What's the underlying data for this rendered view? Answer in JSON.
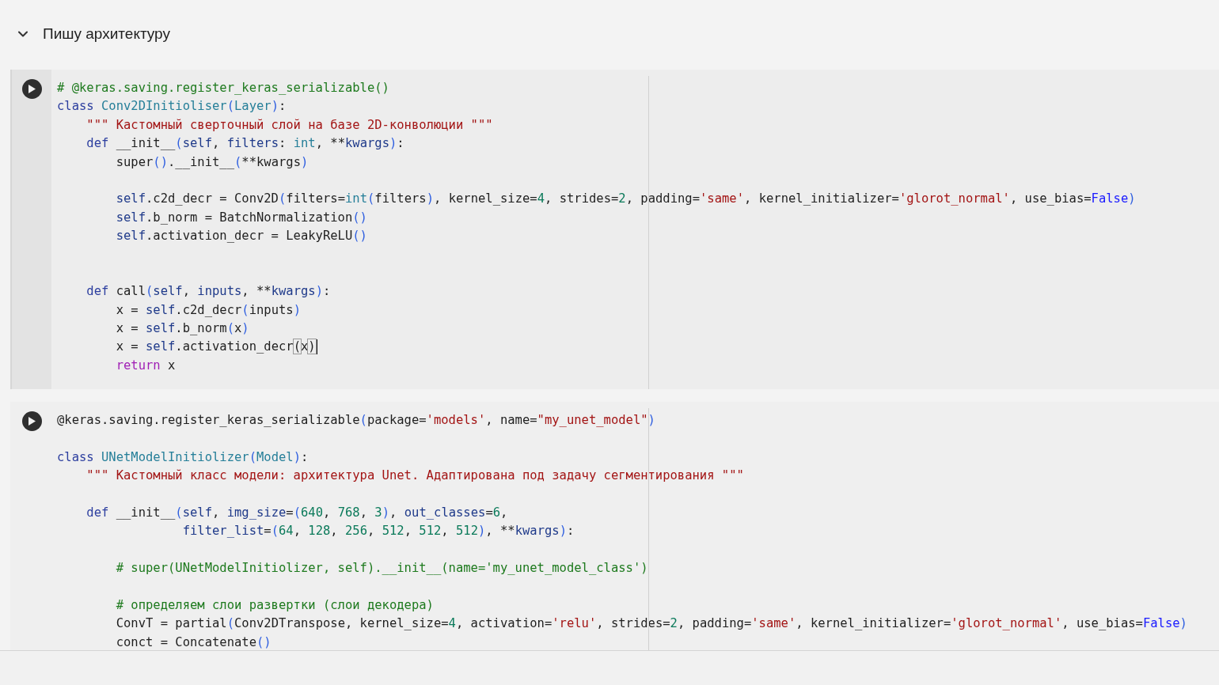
{
  "section": {
    "title": "Пишу архитектуру",
    "expanded": true
  },
  "cells": [
    {
      "focused": true,
      "lines": [
        {
          "kind": "code",
          "tokens": [
            {
              "kind": "comment",
              "text": "# @keras.saving.register_keras_serializable()"
            }
          ]
        },
        {
          "kind": "code",
          "tokens": [
            {
              "kind": "keyword",
              "text": "class "
            },
            {
              "kind": "type",
              "text": "Conv2DInitioliser"
            },
            {
              "kind": "paren",
              "text": "("
            },
            {
              "kind": "type",
              "text": "Layer"
            },
            {
              "kind": "paren",
              "text": ")"
            },
            {
              "kind": "plain",
              "text": ":"
            }
          ]
        },
        {
          "kind": "code",
          "tokens": [
            {
              "kind": "string",
              "text": "    \"\"\" Кастомный сверточный слой на базе 2D-конволюции \"\"\""
            }
          ]
        },
        {
          "kind": "code",
          "tokens": [
            {
              "kind": "keyword",
              "text": "    def"
            },
            {
              "kind": "plain",
              "text": " __init__"
            },
            {
              "kind": "paren",
              "text": "("
            },
            {
              "kind": "variable",
              "text": "self"
            },
            {
              "kind": "plain",
              "text": ", "
            },
            {
              "kind": "variable",
              "text": "filters"
            },
            {
              "kind": "plain",
              "text": ": "
            },
            {
              "kind": "type",
              "text": "int"
            },
            {
              "kind": "plain",
              "text": ", **"
            },
            {
              "kind": "variable",
              "text": "kwargs"
            },
            {
              "kind": "paren",
              "text": ")"
            },
            {
              "kind": "plain",
              "text": ":"
            }
          ]
        },
        {
          "kind": "code",
          "tokens": [
            {
              "kind": "plain",
              "text": "        super"
            },
            {
              "kind": "paren",
              "text": "()"
            },
            {
              "kind": "plain",
              "text": ".__init__"
            },
            {
              "kind": "paren",
              "text": "("
            },
            {
              "kind": "plain",
              "text": "**kwargs"
            },
            {
              "kind": "paren",
              "text": ")"
            }
          ]
        },
        {
          "kind": "blank"
        },
        {
          "kind": "code",
          "tokens": [
            {
              "kind": "variable",
              "text": "        self"
            },
            {
              "kind": "plain",
              "text": ".c2d_decr = Conv2D"
            },
            {
              "kind": "paren",
              "text": "("
            },
            {
              "kind": "plain",
              "text": "filters="
            },
            {
              "kind": "type",
              "text": "int"
            },
            {
              "kind": "paren",
              "text": "("
            },
            {
              "kind": "plain",
              "text": "filters"
            },
            {
              "kind": "paren",
              "text": ")"
            },
            {
              "kind": "plain",
              "text": ", kernel_size="
            },
            {
              "kind": "number",
              "text": "4"
            },
            {
              "kind": "plain",
              "text": ", strides="
            },
            {
              "kind": "number",
              "text": "2"
            },
            {
              "kind": "plain",
              "text": ", padding="
            },
            {
              "kind": "string",
              "text": "'same'"
            },
            {
              "kind": "plain",
              "text": ", kernel_initializer="
            },
            {
              "kind": "string",
              "text": "'glorot_normal'"
            },
            {
              "kind": "plain",
              "text": ", use_bias="
            },
            {
              "kind": "constant",
              "text": "False"
            },
            {
              "kind": "paren",
              "text": ")"
            }
          ]
        },
        {
          "kind": "code",
          "tokens": [
            {
              "kind": "variable",
              "text": "        self"
            },
            {
              "kind": "plain",
              "text": ".b_norm = BatchNormalization"
            },
            {
              "kind": "paren",
              "text": "()"
            }
          ]
        },
        {
          "kind": "code",
          "tokens": [
            {
              "kind": "variable",
              "text": "        self"
            },
            {
              "kind": "plain",
              "text": ".activation_decr = LeakyReLU"
            },
            {
              "kind": "paren",
              "text": "()"
            }
          ]
        },
        {
          "kind": "blank"
        },
        {
          "kind": "blank"
        },
        {
          "kind": "code",
          "tokens": [
            {
              "kind": "keyword",
              "text": "    def"
            },
            {
              "kind": "plain",
              "text": " call"
            },
            {
              "kind": "paren",
              "text": "("
            },
            {
              "kind": "variable",
              "text": "self"
            },
            {
              "kind": "plain",
              "text": ", "
            },
            {
              "kind": "variable",
              "text": "inputs"
            },
            {
              "kind": "plain",
              "text": ", **"
            },
            {
              "kind": "variable",
              "text": "kwargs"
            },
            {
              "kind": "paren",
              "text": ")"
            },
            {
              "kind": "plain",
              "text": ":"
            }
          ]
        },
        {
          "kind": "code",
          "tokens": [
            {
              "kind": "plain",
              "text": "        x = "
            },
            {
              "kind": "variable",
              "text": "self"
            },
            {
              "kind": "plain",
              "text": ".c2d_decr"
            },
            {
              "kind": "paren",
              "text": "("
            },
            {
              "kind": "plain",
              "text": "inputs"
            },
            {
              "kind": "paren",
              "text": ")"
            }
          ]
        },
        {
          "kind": "code",
          "tokens": [
            {
              "kind": "plain",
              "text": "        x = "
            },
            {
              "kind": "variable",
              "text": "self"
            },
            {
              "kind": "plain",
              "text": ".b_norm"
            },
            {
              "kind": "paren",
              "text": "("
            },
            {
              "kind": "plain",
              "text": "x"
            },
            {
              "kind": "paren",
              "text": ")"
            }
          ]
        },
        {
          "kind": "code",
          "cursor": true,
          "tokens": [
            {
              "kind": "plain",
              "text": "        x = "
            },
            {
              "kind": "variable",
              "text": "self"
            },
            {
              "kind": "plain",
              "text": ".activation_decr"
            },
            {
              "kind": "match",
              "text": "("
            },
            {
              "kind": "plain",
              "text": "x"
            },
            {
              "kind": "match",
              "text": ")"
            }
          ]
        },
        {
          "kind": "code",
          "tokens": [
            {
              "kind": "control",
              "text": "        return"
            },
            {
              "kind": "plain",
              "text": " x"
            }
          ]
        }
      ]
    },
    {
      "focused": false,
      "lines": [
        {
          "kind": "code",
          "tokens": [
            {
              "kind": "plain",
              "text": "@keras.saving.register_keras_serializable"
            },
            {
              "kind": "paren",
              "text": "("
            },
            {
              "kind": "plain",
              "text": "package="
            },
            {
              "kind": "string",
              "text": "'models'"
            },
            {
              "kind": "plain",
              "text": ", name="
            },
            {
              "kind": "string",
              "text": "\"my_unet_model\""
            },
            {
              "kind": "paren",
              "text": ")"
            }
          ]
        },
        {
          "kind": "blank"
        },
        {
          "kind": "code",
          "tokens": [
            {
              "kind": "keyword",
              "text": "class "
            },
            {
              "kind": "type",
              "text": "UNetModelInitiolizer"
            },
            {
              "kind": "paren",
              "text": "("
            },
            {
              "kind": "type",
              "text": "Model"
            },
            {
              "kind": "paren",
              "text": ")"
            },
            {
              "kind": "plain",
              "text": ":"
            }
          ]
        },
        {
          "kind": "code",
          "tokens": [
            {
              "kind": "string",
              "text": "    \"\"\" Кастомный класс модели: архитектура Unet. Адаптирована под задачу сегментирования \"\"\""
            }
          ]
        },
        {
          "kind": "blank"
        },
        {
          "kind": "code",
          "tokens": [
            {
              "kind": "keyword",
              "text": "    def"
            },
            {
              "kind": "plain",
              "text": " __init__"
            },
            {
              "kind": "paren",
              "text": "("
            },
            {
              "kind": "variable",
              "text": "self"
            },
            {
              "kind": "plain",
              "text": ", "
            },
            {
              "kind": "variable",
              "text": "img_size"
            },
            {
              "kind": "plain",
              "text": "="
            },
            {
              "kind": "paren",
              "text": "("
            },
            {
              "kind": "number",
              "text": "640"
            },
            {
              "kind": "plain",
              "text": ", "
            },
            {
              "kind": "number",
              "text": "768"
            },
            {
              "kind": "plain",
              "text": ", "
            },
            {
              "kind": "number",
              "text": "3"
            },
            {
              "kind": "paren",
              "text": ")"
            },
            {
              "kind": "plain",
              "text": ", "
            },
            {
              "kind": "variable",
              "text": "out_classes"
            },
            {
              "kind": "plain",
              "text": "="
            },
            {
              "kind": "number",
              "text": "6"
            },
            {
              "kind": "plain",
              "text": ","
            }
          ]
        },
        {
          "kind": "code",
          "tokens": [
            {
              "kind": "variable",
              "text": "                 filter_list"
            },
            {
              "kind": "plain",
              "text": "="
            },
            {
              "kind": "paren",
              "text": "("
            },
            {
              "kind": "number",
              "text": "64"
            },
            {
              "kind": "plain",
              "text": ", "
            },
            {
              "kind": "number",
              "text": "128"
            },
            {
              "kind": "plain",
              "text": ", "
            },
            {
              "kind": "number",
              "text": "256"
            },
            {
              "kind": "plain",
              "text": ", "
            },
            {
              "kind": "number",
              "text": "512"
            },
            {
              "kind": "plain",
              "text": ", "
            },
            {
              "kind": "number",
              "text": "512"
            },
            {
              "kind": "plain",
              "text": ", "
            },
            {
              "kind": "number",
              "text": "512"
            },
            {
              "kind": "paren",
              "text": ")"
            },
            {
              "kind": "plain",
              "text": ", **"
            },
            {
              "kind": "variable",
              "text": "kwargs"
            },
            {
              "kind": "paren",
              "text": ")"
            },
            {
              "kind": "plain",
              "text": ":"
            }
          ]
        },
        {
          "kind": "blank"
        },
        {
          "kind": "code",
          "tokens": [
            {
              "kind": "comment",
              "text": "        # super(UNetModelInitiolizer, self).__init__(name='my_unet_model_class')"
            }
          ]
        },
        {
          "kind": "blank"
        },
        {
          "kind": "code",
          "tokens": [
            {
              "kind": "comment",
              "text": "        # определяем слои развертки (слои декодера)"
            }
          ]
        },
        {
          "kind": "code",
          "tokens": [
            {
              "kind": "plain",
              "text": "        ConvT = partial"
            },
            {
              "kind": "paren",
              "text": "("
            },
            {
              "kind": "plain",
              "text": "Conv2DTranspose, kernel_size="
            },
            {
              "kind": "number",
              "text": "4"
            },
            {
              "kind": "plain",
              "text": ", activation="
            },
            {
              "kind": "string",
              "text": "'relu'"
            },
            {
              "kind": "plain",
              "text": ", strides="
            },
            {
              "kind": "number",
              "text": "2"
            },
            {
              "kind": "plain",
              "text": ", padding="
            },
            {
              "kind": "string",
              "text": "'same'"
            },
            {
              "kind": "plain",
              "text": ", kernel_initializer="
            },
            {
              "kind": "string",
              "text": "'glorot_normal'"
            },
            {
              "kind": "plain",
              "text": ", use_bias="
            },
            {
              "kind": "constant",
              "text": "False"
            },
            {
              "kind": "paren",
              "text": ")"
            }
          ]
        },
        {
          "kind": "code",
          "tokens": [
            {
              "kind": "plain",
              "text": "        conct = Concatenate"
            },
            {
              "kind": "paren",
              "text": "()"
            }
          ]
        }
      ]
    }
  ]
}
